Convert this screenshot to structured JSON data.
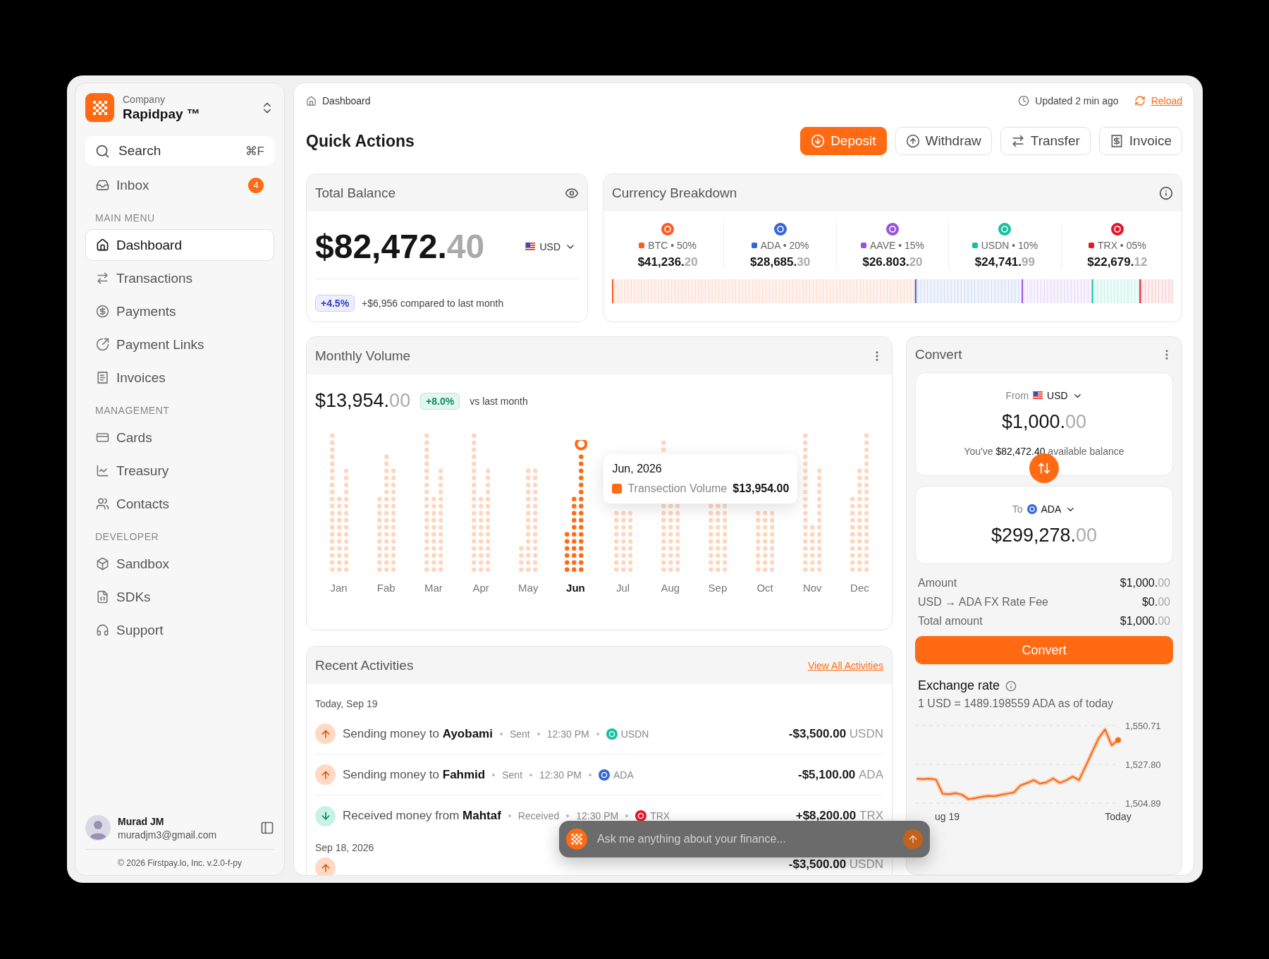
{
  "sidebar": {
    "company_label": "Company",
    "company_name": "Rapidpay ™",
    "search": {
      "placeholder": "Search",
      "shortcut": "⌘F"
    },
    "inbox": {
      "label": "Inbox",
      "badge": "4"
    },
    "sections": [
      {
        "title": "MAIN MENU",
        "items": [
          {
            "label": "Dashboard",
            "selected": true
          },
          {
            "label": "Transactions",
            "selected": false
          },
          {
            "label": "Payments",
            "selected": false
          },
          {
            "label": "Payment Links",
            "selected": false
          },
          {
            "label": "Invoices",
            "selected": false
          }
        ]
      },
      {
        "title": "MANAGEMENT",
        "items": [
          {
            "label": "Cards",
            "selected": false
          },
          {
            "label": "Treasury",
            "selected": false
          },
          {
            "label": "Contacts",
            "selected": false
          }
        ]
      },
      {
        "title": "DEVELOPER",
        "items": [
          {
            "label": "Sandbox",
            "selected": false
          },
          {
            "label": "SDKs",
            "selected": false
          },
          {
            "label": "Support",
            "selected": false
          }
        ]
      }
    ],
    "user": {
      "name": "Murad JM",
      "email": "muradjm3@gmail.com"
    },
    "footer": "© 2026 Firstpay.Io, Inc. v.2.0-f-py"
  },
  "header": {
    "breadcrumb": "Dashboard",
    "updated": "Updated 2 min ago",
    "reload": "Reload",
    "title": "Quick Actions",
    "actions": [
      {
        "label": "Deposit",
        "kind": "primary"
      },
      {
        "label": "Withdraw",
        "kind": "default"
      },
      {
        "label": "Transfer",
        "kind": "default"
      },
      {
        "label": "Invoice",
        "kind": "default"
      }
    ]
  },
  "balance": {
    "title": "Total Balance",
    "whole": "$82,472.",
    "decimals": "40",
    "currency": "USD",
    "change": "+4.5%",
    "comparison": "+$6,956 compared to last month"
  },
  "breakdown": {
    "title": "Currency Breakdown",
    "currencies": [
      {
        "label": "BTC • 50%",
        "whole": "$41,236.",
        "decimals": "20",
        "color": "#ff5a1f"
      },
      {
        "label": "ADA • 20%",
        "whole": "$28,685.",
        "decimals": "30",
        "color": "#3466d6"
      },
      {
        "label": "AAVE • 15%",
        "whole": "$26.803.",
        "decimals": "20",
        "color": "#9b51e0"
      },
      {
        "label": "USDN • 10%",
        "whole": "$24,741.",
        "decimals": "99",
        "color": "#13c29c"
      },
      {
        "label": "TRX • 05%",
        "whole": "$22,679.",
        "decimals": "12",
        "color": "#e5162a"
      }
    ]
  },
  "volume": {
    "title": "Monthly Volume",
    "whole": "$13,954.",
    "decimals": "00",
    "change": "+8.0%",
    "comparison": "vs last month",
    "months": [
      {
        "label": "Jan",
        "selected": false
      },
      {
        "label": "Fab",
        "selected": false
      },
      {
        "label": "Mar",
        "selected": false
      },
      {
        "label": "Apr",
        "selected": false
      },
      {
        "label": "May",
        "selected": false
      },
      {
        "label": "Jun",
        "selected": true
      },
      {
        "label": "Jul",
        "selected": false
      },
      {
        "label": "Aug",
        "selected": false
      },
      {
        "label": "Sep",
        "selected": false
      },
      {
        "label": "Oct",
        "selected": false
      },
      {
        "label": "Nov",
        "selected": false
      },
      {
        "label": "Dec",
        "selected": false
      }
    ],
    "tooltip": {
      "title": "Jun, 2026",
      "series": "Transection Volume",
      "value": "$13,954.00"
    }
  },
  "activities": {
    "title": "Recent Activities",
    "link": "View All Activities",
    "groups": [
      {
        "date": "Today, Sep 19",
        "items": [
          {
            "kind": "sent",
            "text": "Sending money to **Ayobami**",
            "status": "Sent",
            "time": "12:30 PM",
            "currency": "USDN",
            "color": "#13c29c",
            "amount": "-$3,500.00",
            "unit": "USDN"
          },
          {
            "kind": "sent",
            "text": "Sending money to **Fahmid**",
            "status": "Sent",
            "time": "12:30 PM",
            "currency": "ADA",
            "color": "#3466d6",
            "amount": "-$5,100.00",
            "unit": "ADA"
          },
          {
            "kind": "received",
            "text": "Received money from **Mahtaf**",
            "status": "Received",
            "time": "12:30 PM",
            "currency": "TRX",
            "color": "#e5162a",
            "amount": "+$8,200.00",
            "unit": "TRX"
          }
        ]
      },
      {
        "date": "Sep 18, 2026",
        "items": [
          {
            "kind": "sent",
            "amount": "-$3,500.00",
            "unit": "USDN"
          }
        ]
      }
    ]
  },
  "convert": {
    "title": "Convert",
    "from": {
      "label": "From",
      "currency": "USD",
      "whole": "$1,000.",
      "decimals": "00",
      "note": "You've **$82,472.40** available balance"
    },
    "to": {
      "label": "To",
      "currency": "ADA",
      "whole": "$299,278.",
      "decimals": "00"
    },
    "rows": [
      {
        "label": "Amount",
        "whole": "$1,000.",
        "decimals": "00"
      },
      {
        "label": "USD → ADA FX Rate Fee",
        "whole": "$0.",
        "decimals": "00"
      },
      {
        "label": "Total amount",
        "whole": "$1,000.",
        "decimals": "00"
      }
    ],
    "button": "Convert",
    "rate_title": "Exchange rate",
    "rate_text": "1 USD = 1489.198559 ADA as of today",
    "chart_data": {
      "type": "line",
      "ylim": [
        1504.89,
        1550.71
      ],
      "series": [
        {
          "color": "#ff6a13",
          "values": [
            1519.3,
            1519.1,
            1519.4,
            1518.8,
            1510.5,
            1510.2,
            1510.8,
            1509.9,
            1507.2,
            1507.9,
            1508.6,
            1509.2,
            1509.0,
            1509.8,
            1510.5,
            1511.3,
            1515.4,
            1516.8,
            1518.5,
            1516.4,
            1517.2,
            1519.5,
            1516.9,
            1518.3,
            1520.6,
            1518.5,
            1526.7,
            1535.0,
            1543.2,
            1548.4,
            1539.1,
            1542.2
          ]
        }
      ],
      "yticks": [
        {
          "value": 1550.71,
          "label": "1,550.71"
        },
        {
          "value": 1527.8,
          "label": "1,527.80"
        },
        {
          "value": 1504.89,
          "label": "1,504.89"
        }
      ]
    },
    "x_labels": [
      "ug 19",
      "Today"
    ]
  },
  "assistant": {
    "placeholder": "Ask me anything about your finance..."
  }
}
